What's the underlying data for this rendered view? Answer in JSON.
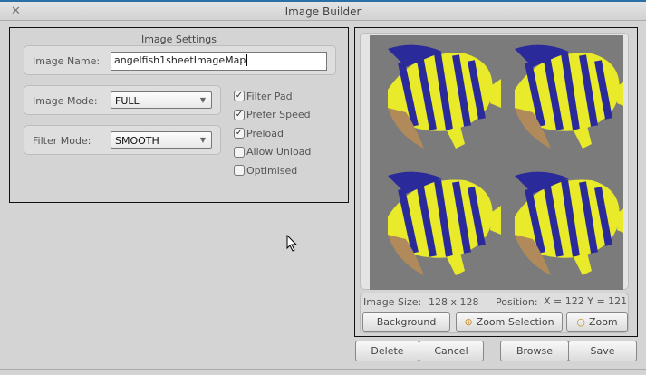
{
  "window": {
    "title": "Image Builder",
    "close_icon": "close-icon"
  },
  "settings": {
    "heading": "Image Settings",
    "image_name_label": "Image Name:",
    "image_name_value": "angelfish1sheetImageMap",
    "image_mode_label": "Image Mode:",
    "image_mode_value": "FULL",
    "filter_mode_label": "Filter Mode:",
    "filter_mode_value": "SMOOTH",
    "checkboxes": [
      {
        "label": "Filter Pad",
        "checked": true
      },
      {
        "label": "Prefer Speed",
        "checked": true
      },
      {
        "label": "Preload",
        "checked": true
      },
      {
        "label": "Allow Unload",
        "checked": false
      },
      {
        "label": "Optimised",
        "checked": false
      }
    ]
  },
  "preview": {
    "image_size_label": "Image Size:",
    "image_size_value": "128 x 128",
    "position_label": "Position:",
    "position_value": "X = 122 Y = 121",
    "background_button": "Background",
    "zoom_selection_button": "Zoom Selection",
    "zoom_button": "Zoom"
  },
  "actions": {
    "delete": "Delete",
    "cancel": "Cancel",
    "browse": "Browse",
    "save": "Save"
  },
  "colors": {
    "image_bg": "#7b7b7b",
    "fish_yellow": "#e8ea2a",
    "fish_blue": "#2a2a9a"
  }
}
